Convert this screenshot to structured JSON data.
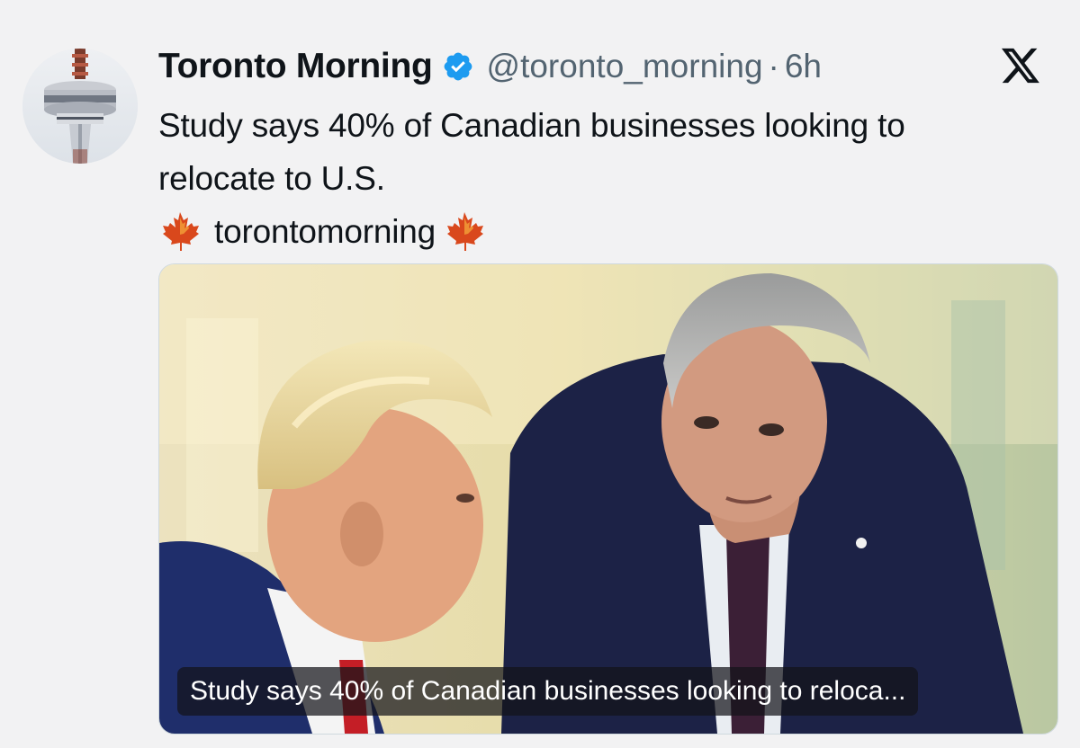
{
  "tweet": {
    "display_name": "Toronto Morning",
    "verified_icon": "verified-badge-icon",
    "handle": "@toronto_morning",
    "separator": "·",
    "time": "6h",
    "text_line1": "Study says 40% of Canadian businesses looking to",
    "text_line2": "relocate to U.S.",
    "text_line3": "torontomorning",
    "leaf_icon": "maple-leaf-icon",
    "platform_icon": "x-logo-icon"
  },
  "media": {
    "caption": "Study says 40% of Canadian businesses looking to reloca..."
  },
  "colors": {
    "background": "#f2f2f3",
    "text": "#0f1419",
    "secondary": "#536471",
    "verified": "#1d9bf0"
  }
}
